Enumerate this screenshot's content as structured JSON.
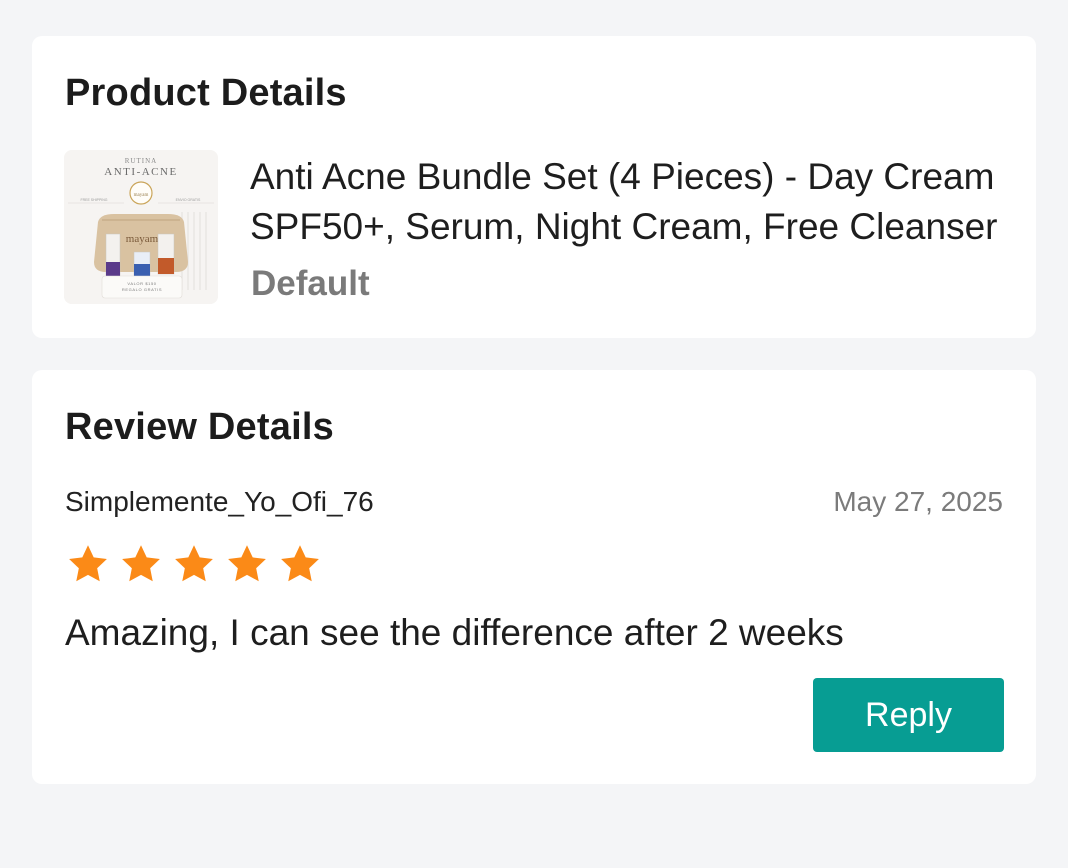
{
  "product_card": {
    "title": "Product Details",
    "product_name": "Anti Acne Bundle Set (4 Pieces) - Day Cream SPF50+, Serum, Night Cream, Free Cleanser",
    "variant": "Default",
    "image": {
      "top_line": "RUTINA",
      "headline": "ANTI-ACNE",
      "brand": "mayam",
      "left_tag": "FREE SHIPPING",
      "right_tag": "ENVIO GRATIS",
      "bottom_line1": "VALOR $150",
      "bottom_line2": "REGALO GRATIS"
    }
  },
  "review_card": {
    "title": "Review Details",
    "reviewer": "Simplemente_Yo_Ofi_76",
    "date": "May 27, 2025",
    "rating": 5,
    "review_text": "Amazing, I can see the difference after 2 weeks",
    "reply_label": "Reply"
  },
  "colors": {
    "page_bg": "#f4f5f7",
    "card_bg": "#ffffff",
    "star": "#fb8a17",
    "reply_button": "#079d93",
    "muted_text": "#7a7a7a"
  },
  "icons": {
    "star": "star-icon"
  }
}
